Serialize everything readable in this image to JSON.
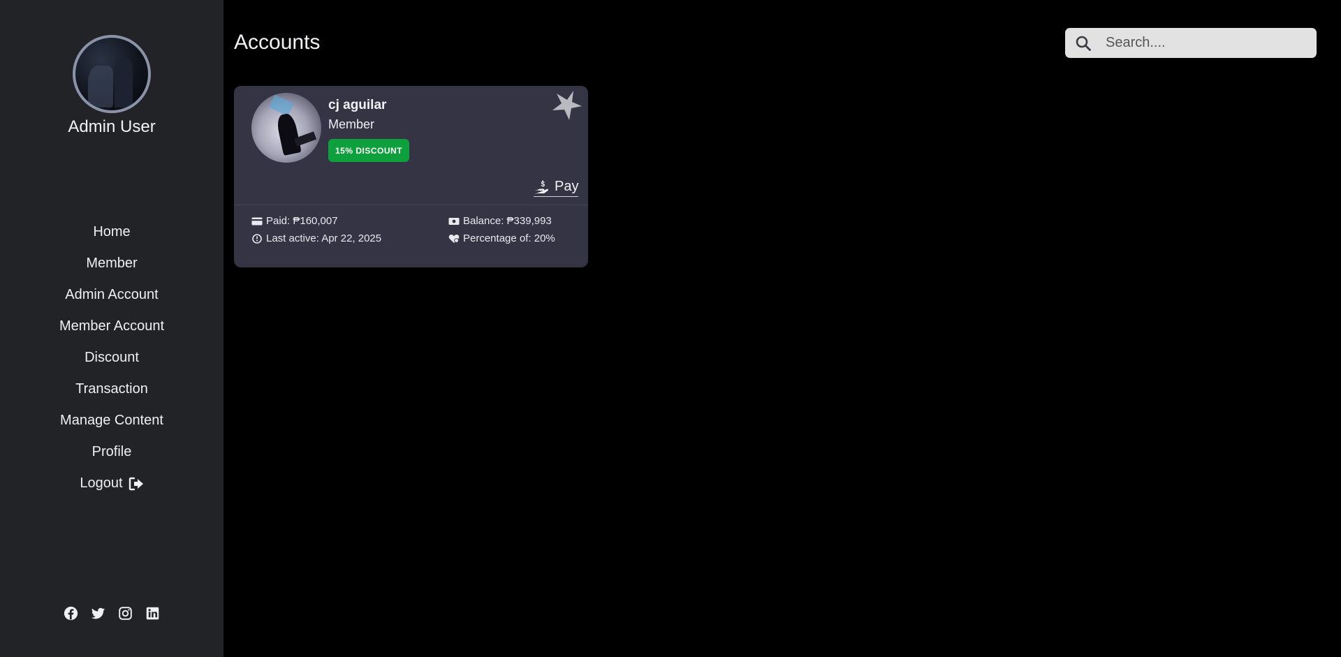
{
  "sidebar": {
    "admin_name": "Admin User",
    "nav": [
      {
        "label": "Home"
      },
      {
        "label": "Member"
      },
      {
        "label": "Admin Account"
      },
      {
        "label": "Member Account"
      },
      {
        "label": "Discount"
      },
      {
        "label": "Transaction"
      },
      {
        "label": "Manage Content"
      },
      {
        "label": "Profile"
      },
      {
        "label": "Logout",
        "icon": "logout-icon"
      }
    ],
    "social_icons": [
      "facebook-icon",
      "twitter-icon",
      "instagram-icon",
      "linkedin-icon"
    ]
  },
  "header": {
    "title": "Accounts",
    "search_placeholder": "Search...."
  },
  "accounts": [
    {
      "name": "cj aguilar",
      "role": "Member",
      "discount_badge": "15% DISCOUNT",
      "pay_label": "Pay",
      "paid": "Paid: ₱160,007",
      "last_active": "Last active: Apr 22, 2025",
      "balance": "Balance: ₱339,993",
      "percentage": "Percentage of: 20%"
    }
  ],
  "colors": {
    "background": "#000000",
    "sidebar": "#222327",
    "card": "#353444",
    "badge": "#0ea03c",
    "search": "#e2e2e2"
  }
}
